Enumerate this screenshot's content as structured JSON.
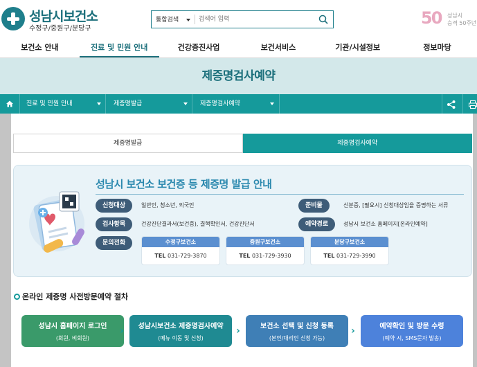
{
  "header": {
    "logo_title": "성남시보건소",
    "logo_sub": "수정구/중원구/분당구",
    "search_scope": "통합검색",
    "search_placeholder": "검색어 입력",
    "anniv_num": "50",
    "anniv_line1": "성남시",
    "anniv_line2": "승격 50주년"
  },
  "nav": {
    "items": [
      "보건소 안내",
      "진료 및 민원 안내",
      "건강증진사업",
      "보건서비스",
      "기관/시설정보",
      "정보마당"
    ],
    "active_index": 1
  },
  "page": {
    "title": "제증명검사예약"
  },
  "breadcrumb": {
    "items": [
      "진료 및 민원 안내",
      "제증명발급",
      "제증명검사예약"
    ]
  },
  "tabs": {
    "items": [
      "제증명발급",
      "제증명검사예약"
    ],
    "active_index": 1
  },
  "info": {
    "title": "성남시 보건소 보건증 등 제증명 발급 안내",
    "rows": [
      {
        "label": "신청대상",
        "value": "일반인, 청소년, 외국인"
      },
      {
        "label": "준비물",
        "value": "신분증, [필요시] 신청대상임을 증명하는 서류"
      },
      {
        "label": "검사항목",
        "value": "건강진단결과서(보건증), 결핵확인서, 건강진단서"
      },
      {
        "label": "예약경로",
        "value": "성남시 보건소 홈페이지[온라인예약]"
      },
      {
        "label": "문의전화",
        "value": ""
      }
    ],
    "contacts": [
      {
        "name": "수정구보건소",
        "tel_label": "TEL",
        "tel": "031-729-3870"
      },
      {
        "name": "중원구보건소",
        "tel_label": "TEL",
        "tel": "031-729-3930"
      },
      {
        "name": "분당구보건소",
        "tel_label": "TEL",
        "tel": "031-729-3990"
      }
    ]
  },
  "procedure": {
    "title": "온라인 제증명 사전방문예약 절차",
    "steps": [
      {
        "title": "성남시 홈페이지 로그인",
        "sub": "(회원, 비회원)",
        "color": "#3a9a6a"
      },
      {
        "title": "성남시보건소 제증명검사예약",
        "sub": "(메뉴 이동 및 신청)",
        "color": "#1f8a92"
      },
      {
        "title": "보건소 선택 및 신청 등록",
        "sub": "(본인/대리인 신청 가능)",
        "color": "#3f7fb6"
      },
      {
        "title": "예약확인 및 방문 수령",
        "sub": "(예약 시, SMS문자 발송)",
        "color": "#4d82db"
      }
    ]
  },
  "colors": {
    "brand": "#1b6f7b",
    "teal": "#159a9b",
    "pill": "#3e5c78"
  }
}
